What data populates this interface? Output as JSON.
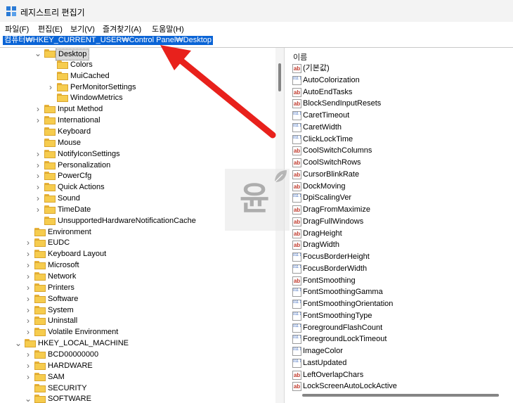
{
  "window": {
    "title": "레지스트리 편집기"
  },
  "menu": [
    {
      "label": "파일(F)"
    },
    {
      "label": "편집(E)"
    },
    {
      "label": "보기(V)"
    },
    {
      "label": "즐겨찾기(A)"
    },
    {
      "label": "도움말(H)"
    }
  ],
  "address": {
    "path": "컴퓨터₩HKEY_CURRENT_USER₩Control Panel₩Desktop"
  },
  "tree": [
    {
      "label": "Desktop",
      "depth": 2,
      "selected": true,
      "chev": "v"
    },
    {
      "label": "Colors",
      "depth": 3,
      "chev": ""
    },
    {
      "label": "MuiCached",
      "depth": 3,
      "chev": ""
    },
    {
      "label": "PerMonitorSettings",
      "depth": 3,
      "chev": ">"
    },
    {
      "label": "WindowMetrics",
      "depth": 3,
      "chev": ""
    },
    {
      "label": "Input Method",
      "depth": 2,
      "chev": ">"
    },
    {
      "label": "International",
      "depth": 2,
      "chev": ">"
    },
    {
      "label": "Keyboard",
      "depth": 2,
      "chev": ""
    },
    {
      "label": "Mouse",
      "depth": 2,
      "chev": ""
    },
    {
      "label": "NotifyIconSettings",
      "depth": 2,
      "chev": ">"
    },
    {
      "label": "Personalization",
      "depth": 2,
      "chev": ">"
    },
    {
      "label": "PowerCfg",
      "depth": 2,
      "chev": ">"
    },
    {
      "label": "Quick Actions",
      "depth": 2,
      "chev": ">"
    },
    {
      "label": "Sound",
      "depth": 2,
      "chev": ">"
    },
    {
      "label": "TimeDate",
      "depth": 2,
      "chev": ">"
    },
    {
      "label": "UnsupportedHardwareNotificationCache",
      "depth": 2,
      "chev": ""
    },
    {
      "label": "Environment",
      "depth": 1,
      "chev": ""
    },
    {
      "label": "EUDC",
      "depth": 1,
      "chev": ">"
    },
    {
      "label": "Keyboard Layout",
      "depth": 1,
      "chev": ">"
    },
    {
      "label": "Microsoft",
      "depth": 1,
      "chev": ">"
    },
    {
      "label": "Network",
      "depth": 1,
      "chev": ">"
    },
    {
      "label": "Printers",
      "depth": 1,
      "chev": ">"
    },
    {
      "label": "Software",
      "depth": 1,
      "chev": ">"
    },
    {
      "label": "System",
      "depth": 1,
      "chev": ">"
    },
    {
      "label": "Uninstall",
      "depth": 1,
      "chev": ">"
    },
    {
      "label": "Volatile Environment",
      "depth": 1,
      "chev": ">"
    },
    {
      "label": "HKEY_LOCAL_MACHINE",
      "depth": 0,
      "chev": "v"
    },
    {
      "label": "BCD00000000",
      "depth": 1,
      "chev": ">"
    },
    {
      "label": "HARDWARE",
      "depth": 1,
      "chev": ">"
    },
    {
      "label": "SAM",
      "depth": 1,
      "chev": ">"
    },
    {
      "label": "SECURITY",
      "depth": 1,
      "chev": ""
    },
    {
      "label": "SOFTWARE",
      "depth": 1,
      "chev": "v"
    }
  ],
  "values_header": {
    "name": "이름"
  },
  "values": [
    {
      "name": "(기본값)",
      "type": "sz"
    },
    {
      "name": "AutoColorization",
      "type": "bin"
    },
    {
      "name": "AutoEndTasks",
      "type": "sz"
    },
    {
      "name": "BlockSendInputResets",
      "type": "sz"
    },
    {
      "name": "CaretTimeout",
      "type": "bin"
    },
    {
      "name": "CaretWidth",
      "type": "bin"
    },
    {
      "name": "ClickLockTime",
      "type": "bin"
    },
    {
      "name": "CoolSwitchColumns",
      "type": "sz"
    },
    {
      "name": "CoolSwitchRows",
      "type": "sz"
    },
    {
      "name": "CursorBlinkRate",
      "type": "sz"
    },
    {
      "name": "DockMoving",
      "type": "sz"
    },
    {
      "name": "DpiScalingVer",
      "type": "bin"
    },
    {
      "name": "DragFromMaximize",
      "type": "sz"
    },
    {
      "name": "DragFullWindows",
      "type": "sz"
    },
    {
      "name": "DragHeight",
      "type": "sz"
    },
    {
      "name": "DragWidth",
      "type": "sz"
    },
    {
      "name": "FocusBorderHeight",
      "type": "bin"
    },
    {
      "name": "FocusBorderWidth",
      "type": "bin"
    },
    {
      "name": "FontSmoothing",
      "type": "sz"
    },
    {
      "name": "FontSmoothingGamma",
      "type": "bin"
    },
    {
      "name": "FontSmoothingOrientation",
      "type": "bin"
    },
    {
      "name": "FontSmoothingType",
      "type": "bin"
    },
    {
      "name": "ForegroundFlashCount",
      "type": "bin"
    },
    {
      "name": "ForegroundLockTimeout",
      "type": "bin"
    },
    {
      "name": "ImageColor",
      "type": "bin"
    },
    {
      "name": "LastUpdated",
      "type": "bin"
    },
    {
      "name": "LeftOverlapChars",
      "type": "sz"
    },
    {
      "name": "LockScreenAutoLockActive",
      "type": "sz"
    }
  ],
  "watermark": {
    "text": "윤"
  },
  "colors": {
    "selection": "#0a64d6",
    "folder": "#f6cc4e",
    "arrow": "#e8211c"
  }
}
